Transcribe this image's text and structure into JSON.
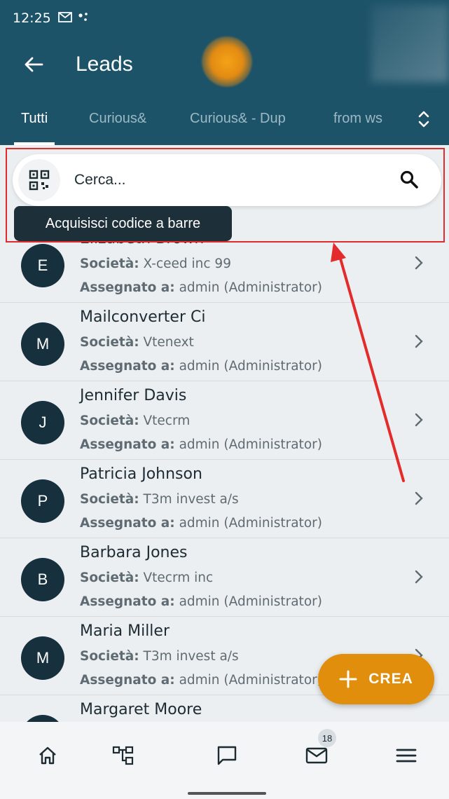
{
  "status_bar": {
    "time": "12:25",
    "icons": [
      "gmail-icon",
      "dots-icon"
    ]
  },
  "header": {
    "title": "Leads"
  },
  "tabs": [
    {
      "label": "Tutti",
      "active": true
    },
    {
      "label": "Curious&",
      "active": false
    },
    {
      "label": "Curious& - Dup",
      "active": false
    },
    {
      "label": "from ws",
      "active": false
    }
  ],
  "search": {
    "placeholder": "Cerca..."
  },
  "tooltip": {
    "text": "Acquisisci codice a barre"
  },
  "field_labels": {
    "company": "Società:",
    "assigned": "Assegnato a:"
  },
  "leads": [
    {
      "initial": "E",
      "name": "Elizabeth Brown",
      "company": "X-ceed inc 99",
      "assigned": "admin (Administrator)"
    },
    {
      "initial": "M",
      "name": "Mailconverter Ci",
      "company": "Vtenext",
      "assigned": "admin (Administrator)"
    },
    {
      "initial": "J",
      "name": "Jennifer Davis",
      "company": "Vtecrm",
      "assigned": "admin (Administrator)"
    },
    {
      "initial": "P",
      "name": "Patricia Johnson",
      "company": "T3m invest a/s",
      "assigned": "admin (Administrator)"
    },
    {
      "initial": "B",
      "name": "Barbara Jones",
      "company": "Vtecrm inc",
      "assigned": "admin (Administrator)"
    },
    {
      "initial": "M",
      "name": "Maria Miller",
      "company": "T3m invest a/s",
      "assigned": "admin (Administrator)"
    },
    {
      "initial": "M",
      "name": "Margaret Moore",
      "company": "",
      "assigned": ""
    }
  ],
  "fab": {
    "label": "CREA"
  },
  "bottom_nav": {
    "mail_badge": "18"
  },
  "colors": {
    "primary": "#1d5369",
    "accent": "#e08e0b",
    "avatar": "#16303d",
    "highlight": "#e32b2b"
  }
}
